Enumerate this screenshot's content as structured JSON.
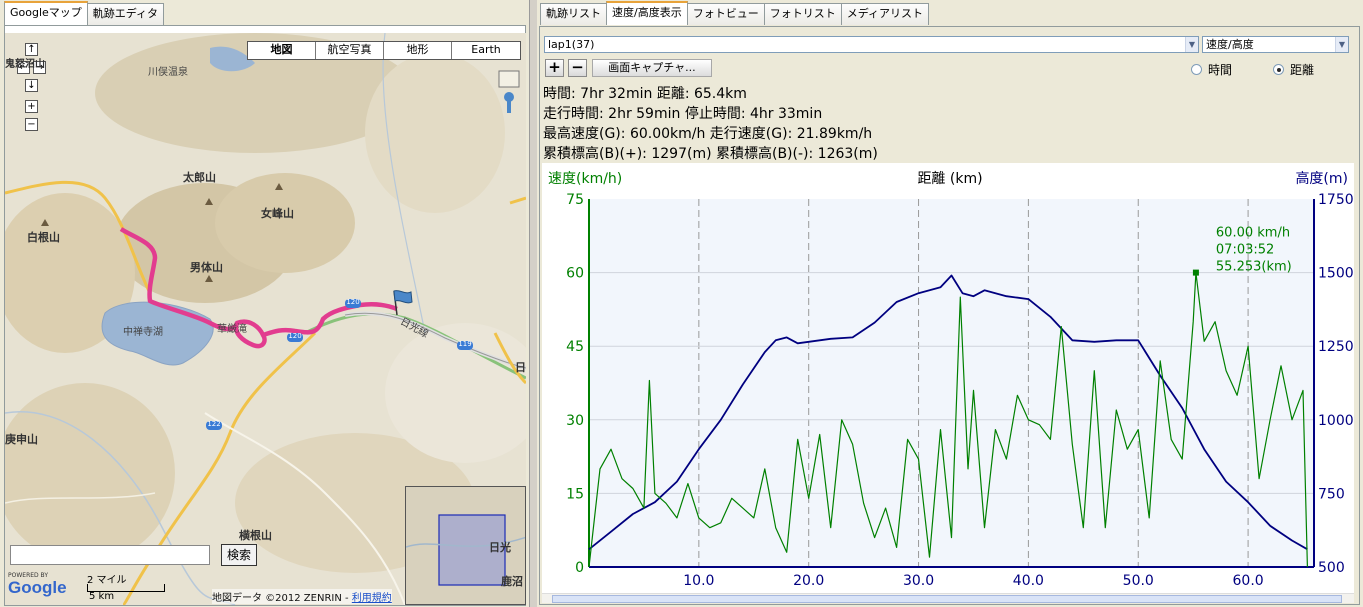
{
  "left_tabs": [
    "Googleマップ",
    "軌跡エディタ"
  ],
  "right_tabs": [
    "軌跡リスト",
    "速度/高度表示",
    "フォトビュー",
    "フォトリスト",
    "メディアリスト"
  ],
  "map": {
    "types": [
      "地図",
      "航空写真",
      "地形",
      "Earth"
    ],
    "labels": {
      "kawamata": "川俣温泉",
      "taro": "太郎山",
      "nyoho": "女峰山",
      "shirane": "白根山",
      "nantai": "男体山",
      "chuzenji": "中禅寺湖",
      "kegon": "華厳滝",
      "nikko_line": "日光線",
      "sodeyama": "庚申山",
      "yokone": "横根山",
      "ov_nikko": "日光",
      "ov_kanuma": "鹿沼",
      "r119": "119",
      "r120a": "120",
      "r120b": "120",
      "r122": "122",
      "partial_top": "鬼怒沼山",
      "partial_right": "日"
    },
    "search_button": "検索",
    "search_value": "",
    "powered_by": "POWERED BY",
    "google": "Google",
    "scale_top": "2 マイル",
    "scale_bottom": "5 km",
    "copyright": "地図データ ©2012 ZENRIN - ",
    "terms_link": "利用規約",
    "nav": {
      "up": "↑",
      "down": "↓",
      "left": "←",
      "right": "→",
      "zoom_in": "+",
      "zoom_out": "−"
    }
  },
  "panel": {
    "lap_select": "lap1(37)",
    "mode_select": "速度/高度",
    "plus": "+",
    "minus": "−",
    "capture_button": "画面キャプチャ...",
    "radio_time": "時間",
    "radio_distance": "距離",
    "radio_selected": "distance"
  },
  "stats": {
    "line1": "時間: 7hr 32min  距離: 65.4km",
    "line2": "走行時間: 2hr 59min  停止時間: 4hr 33min",
    "line3": "最高速度(G): 60.00km/h  走行速度(G): 21.89km/h",
    "line4": "累積標高(B)(+): 1297(m)  累積標高(B)(-): 1263(m)"
  },
  "chart_data": {
    "type": "line",
    "title": "距離 (km)",
    "ylabel_left": "速度(km/h)",
    "ylabel_right": "高度(m)",
    "xlim": [
      0,
      66
    ],
    "ylim_left": [
      0,
      75
    ],
    "ylim_right": [
      500,
      1750
    ],
    "x_ticks": [
      "10.0",
      "20.0",
      "30.0",
      "40.0",
      "50.0",
      "60.0"
    ],
    "y_left_ticks": [
      "0",
      "15",
      "30",
      "45",
      "60",
      "75"
    ],
    "y_right_ticks": [
      "500",
      "750",
      "1000",
      "1250",
      "1500",
      "1750"
    ],
    "grid": true,
    "colors": {
      "speed": "#008000",
      "altitude": "#000080"
    },
    "annotation": {
      "speed": "60.00 km/h",
      "time": "07:03:52",
      "distance": "55.253(km)",
      "x": 55.25,
      "y": 60
    },
    "series": [
      {
        "name": "高度(m)",
        "axis": "right",
        "x": [
          0,
          2,
          4,
          6,
          8,
          10,
          12,
          14,
          16,
          17,
          18,
          19,
          20,
          22,
          24,
          26,
          28,
          30,
          32,
          33,
          34,
          35,
          36,
          37,
          38,
          40,
          42,
          44,
          46,
          48,
          50,
          52,
          54,
          56,
          58,
          60,
          62,
          64,
          65.4
        ],
        "y": [
          560,
          620,
          680,
          720,
          790,
          900,
          1000,
          1120,
          1230,
          1270,
          1280,
          1260,
          1265,
          1275,
          1280,
          1330,
          1400,
          1430,
          1450,
          1490,
          1430,
          1420,
          1440,
          1430,
          1420,
          1410,
          1350,
          1270,
          1265,
          1270,
          1270,
          1150,
          1040,
          900,
          790,
          720,
          640,
          590,
          560
        ]
      },
      {
        "name": "速度(km/h)",
        "axis": "left",
        "x": [
          0,
          1,
          2,
          3,
          4,
          5,
          5.5,
          6,
          7,
          8,
          9,
          10,
          11,
          12,
          13,
          14,
          15,
          16,
          17,
          18,
          19,
          20,
          21,
          22,
          23,
          24,
          25,
          26,
          27,
          28,
          29,
          30,
          31,
          32,
          33,
          33.8,
          34.5,
          35,
          36,
          37,
          38,
          39,
          40,
          41,
          42,
          43,
          44,
          45,
          46,
          47,
          48,
          49,
          50,
          51,
          52,
          53,
          54,
          55,
          55.25,
          56,
          57,
          58,
          59,
          60,
          61,
          62,
          63,
          64,
          65,
          65.4
        ],
        "y": [
          0,
          20,
          24,
          18,
          16,
          12,
          38,
          15,
          13,
          10,
          17,
          10,
          8,
          9,
          14,
          12,
          10,
          20,
          8,
          3,
          26,
          14,
          27,
          8,
          30,
          25,
          13,
          6,
          12,
          4,
          26,
          22,
          2,
          28,
          6,
          55,
          20,
          36,
          8,
          28,
          22,
          35,
          30,
          29,
          26,
          49,
          25,
          8,
          40,
          8,
          32,
          24,
          28,
          10,
          42,
          26,
          22,
          50,
          60,
          46,
          50,
          40,
          35,
          45,
          18,
          30,
          41,
          30,
          36,
          0
        ]
      }
    ]
  }
}
